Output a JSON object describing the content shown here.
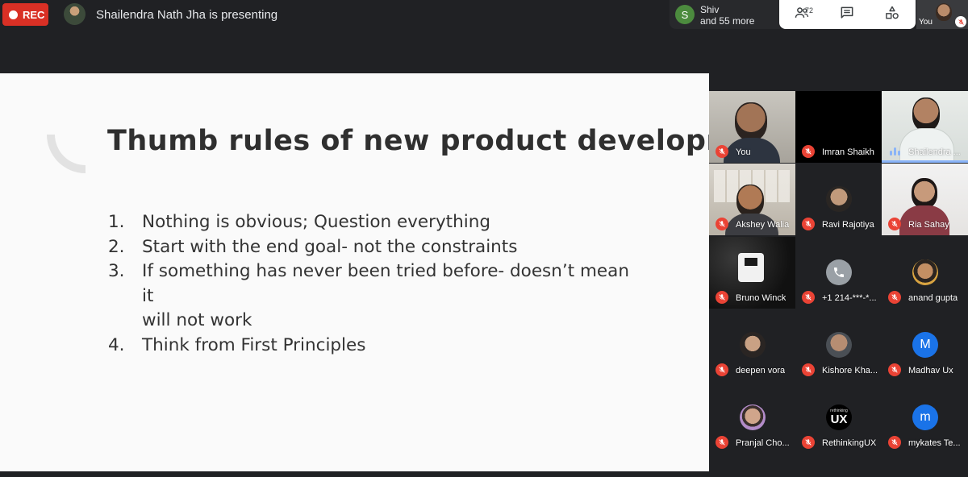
{
  "top_bar": {
    "rec_label": "REC",
    "presenting_text": "Shailendra Nath Jha is presenting",
    "others": {
      "avatar_letter": "S",
      "name": "Shiv",
      "more": "and 55 more"
    },
    "participants_count": "72",
    "self_label": "You"
  },
  "slide": {
    "title": "Thumb rules of new product development",
    "items": [
      {
        "num": "1.",
        "lines": [
          "Nothing is obvious; Question everything"
        ]
      },
      {
        "num": "2.",
        "lines": [
          "Start with the end goal- not the constraints"
        ]
      },
      {
        "num": "3.",
        "lines": [
          "If something has never been tried before- doesn’t mean it",
          "will not work"
        ]
      },
      {
        "num": "4.",
        "lines": [
          "Think from First Principles"
        ]
      }
    ]
  },
  "participants": [
    {
      "name": "You"
    },
    {
      "name": "Imran Shaikh"
    },
    {
      "name": "Shailendra ..."
    },
    {
      "name": "Akshey Walia"
    },
    {
      "name": "Ravi Rajotiya"
    },
    {
      "name": "Ria Sahay"
    },
    {
      "name": "Bruno Winck"
    },
    {
      "name": "+1 214-***-*..."
    },
    {
      "name": "anand gupta"
    },
    {
      "name": "deepen vora"
    },
    {
      "name": "Kishore Kha..."
    },
    {
      "name": "Madhav Ux",
      "avatar_letter": "M"
    },
    {
      "name": "Pranjal Cho..."
    },
    {
      "name": "RethinkingUX",
      "avatar_text": "UX",
      "avatar_small": "rethinking"
    },
    {
      "name": "mykates Te...",
      "avatar_letter": "m"
    }
  ],
  "colors": {
    "background": "#202124",
    "rec_red": "#d93025",
    "mic_off_red": "#ea4335",
    "speaking_blue": "#8ab4f8",
    "avatar_blue": "#1a73e8",
    "avatar_green": "#4c8b3e"
  },
  "icons": [
    "mic-off-icon",
    "people-icon",
    "chat-icon",
    "activities-icon",
    "phone-icon"
  ]
}
